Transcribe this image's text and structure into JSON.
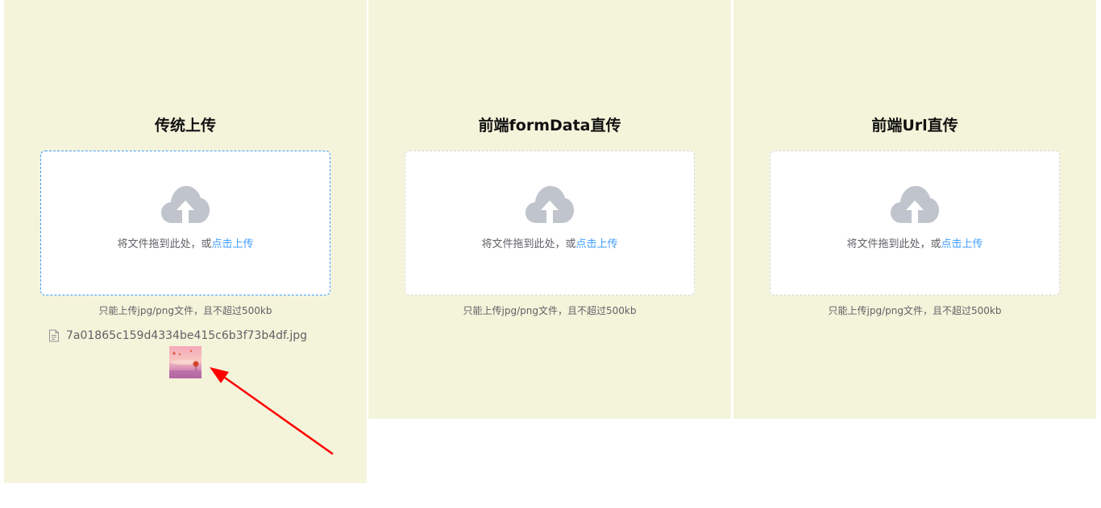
{
  "panels": [
    {
      "title": "传统上传",
      "drop_text": "将文件拖到此处，或",
      "drop_link": "点击上传",
      "tip": "只能上传jpg/png文件，且不超过500kb",
      "uploaded_file": "7a01865c159d4334be415c6b3f73b4df.jpg"
    },
    {
      "title": "前端formData直传",
      "drop_text": "将文件拖到此处，或",
      "drop_link": "点击上传",
      "tip": "只能上传jpg/png文件，且不超过500kb"
    },
    {
      "title": "前端Url直传",
      "drop_text": "将文件拖到此处，或",
      "drop_link": "点击上传",
      "tip": "只能上传jpg/png文件，且不超过500kb"
    }
  ],
  "colors": {
    "panel_bg": "#f4f4db",
    "accent": "#409eff",
    "icon_gray": "#c0c4cc",
    "annotation_arrow": "#ff0000"
  },
  "icons": {
    "upload": "cloud-upload-icon",
    "file": "document-icon"
  }
}
